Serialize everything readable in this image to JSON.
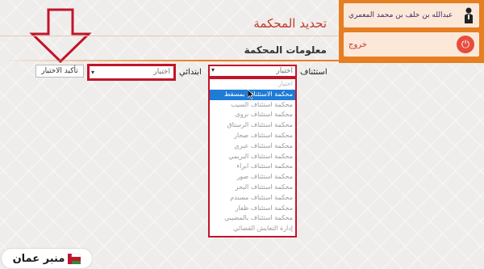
{
  "user": {
    "name": "عبدالله بن خلف بن محمد المعمري",
    "logout_label": "خروج"
  },
  "page": {
    "title": "تحديد المحكمة",
    "section_title": "معلومات المحكمة"
  },
  "form": {
    "appeal_label": "استئناف",
    "appeal_placeholder": "اختيار",
    "primary_label": "ابتدائي",
    "primary_placeholder": "اختيار",
    "confirm_label": "تأكيد الاختيار"
  },
  "dropdown": {
    "items": [
      "اختيار",
      "محكمة الاستئناف بمسقط",
      "محكمة استئناف السيب",
      "محكمة استئناف نزوى",
      "محكمة استئناف الرستاق",
      "محكمة استئناف صحار",
      "محكمة استئناف عبري",
      "محكمة استئناف البريمي",
      "محكمة استئناف ابراء",
      "محكمة استئناف صور",
      "محكمة استئناف البحر",
      "محكمة استئناف مسندم",
      "محكمة استئناف ظفار",
      "محكمة استئناف بالمضيبي",
      "إدارة التعايش القضائي"
    ],
    "selected_index": 1
  },
  "logo": {
    "text": "منبر عمان"
  },
  "colors": {
    "accent": "#e67e22",
    "highlight": "#c0152b",
    "selected": "#1e7bd6"
  }
}
